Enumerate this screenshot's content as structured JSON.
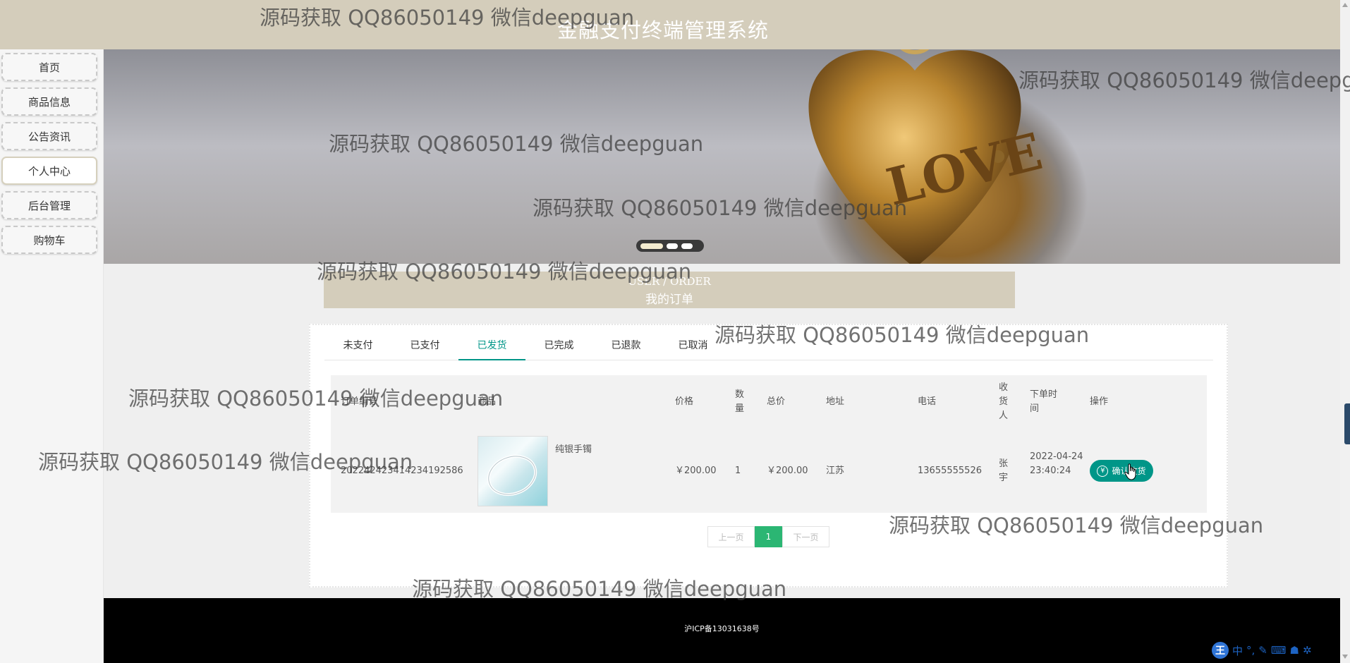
{
  "header": {
    "title": "金融支付终端管理系统"
  },
  "sidebar": {
    "items": [
      {
        "label": "首页",
        "active": false
      },
      {
        "label": "商品信息",
        "active": false
      },
      {
        "label": "公告资讯",
        "active": false
      },
      {
        "label": "个人中心",
        "active": true
      },
      {
        "label": "后台管理",
        "active": false
      },
      {
        "label": "购物车",
        "active": false
      }
    ]
  },
  "banner": {
    "text": "LOVE",
    "slides": 3,
    "active_slide": 1
  },
  "section": {
    "title_en": "USER / ORDER",
    "title_cn": "我的订单"
  },
  "tabs": {
    "items": [
      "未支付",
      "已支付",
      "已发货",
      "已完成",
      "已退款",
      "已取消"
    ],
    "active": "已发货"
  },
  "table": {
    "columns": {
      "order_no": "订单编号",
      "product": "商品",
      "price": "价格",
      "qty": "数量",
      "total": "总价",
      "address": "地址",
      "phone": "电话",
      "receiver": "收货人",
      "time": "下单时间",
      "action": "操作"
    },
    "rows": [
      {
        "order_no": "20224242341423419258​6",
        "product_name": "纯银手镯",
        "price": "￥200.00",
        "qty": "1",
        "total": "￥200.00",
        "address": "江苏",
        "phone": "13655555526",
        "receiver": "张宇",
        "time": "2022-04-24 23:40:24",
        "action_label": "确认收货"
      }
    ]
  },
  "pagination": {
    "prev": "上一页",
    "current": "1",
    "next": "下一页"
  },
  "footer": {
    "icp": "沪ICP备13031638号"
  },
  "watermark": {
    "text": "源码获取 QQ86050149 微信deepguan"
  },
  "colors": {
    "header_bg": "#d4cdbb",
    "accent": "#009688",
    "page_active": "#2bb673",
    "footer_bg": "#000000"
  }
}
